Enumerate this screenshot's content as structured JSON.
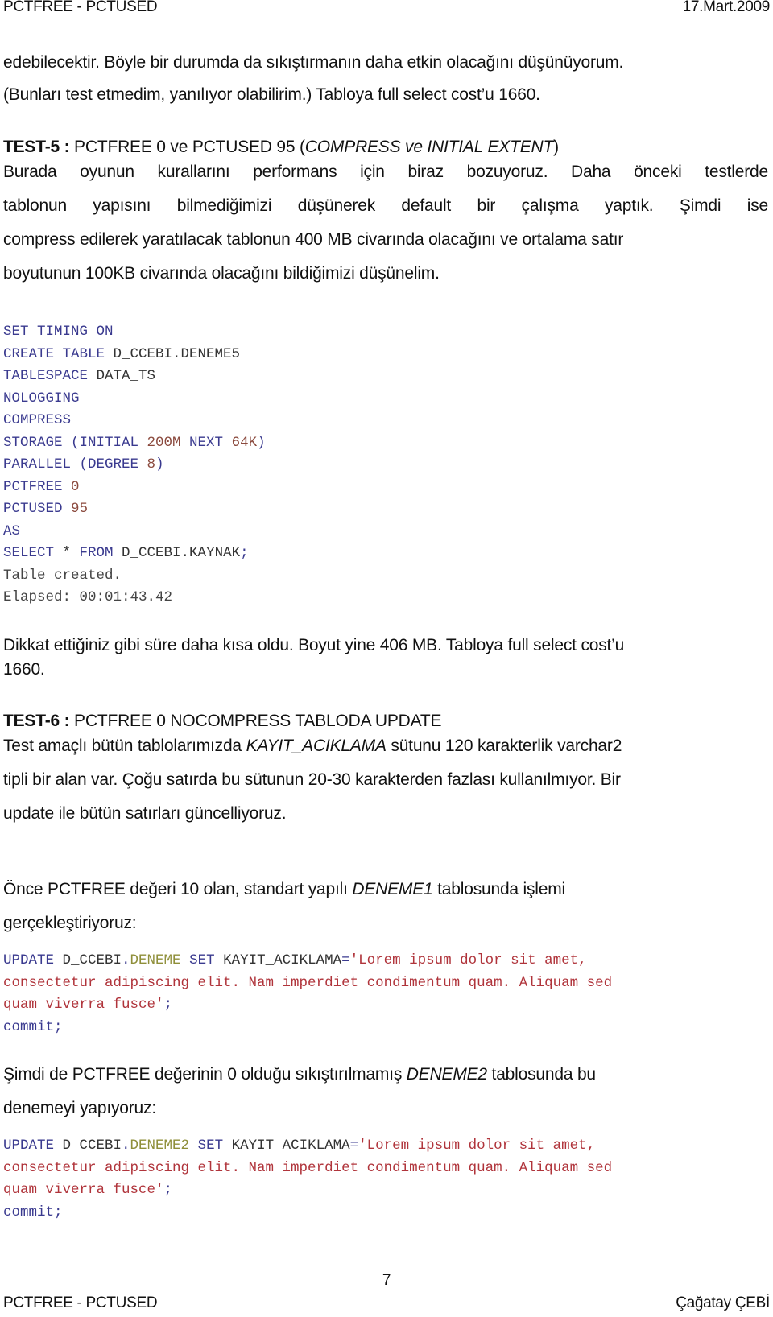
{
  "header": {
    "title": "PCTFREE - PCTUSED",
    "date": "17.Mart.2009"
  },
  "paragraphs": {
    "intro_line1": "edebilecektir. Böyle bir durumda da sıkıştırmanın daha etkin olacağını düşünüyorum.",
    "intro_line2": "(Bunları test etmedim, yanılıyor olabilirim.) Tabloya full select cost’u 1660.",
    "test5_label": "TEST-5 :",
    "test5_title_a": " PCTFREE 0 ve PCTUSED 95 (",
    "test5_title_italic": "COMPRESS ve INITIAL EXTENT",
    "test5_title_b": ")",
    "test5_line1": "Burada oyunun kurallarını performans için biraz bozuyoruz. Daha önceki testlerde",
    "test5_line2": "tablonun yapısını bilmediğimizi düşünerek default bir çalışma yaptık. Şimdi ise",
    "test5_line3": "compress edilerek yaratılacak tablonun 400 MB civarında olacağını ve ortalama satır",
    "test5_line4": "boyutunun 100KB civarında olacağını bildiğimizi düşünelim.",
    "result5_line1": "Dikkat ettiğiniz gibi süre daha kısa oldu. Boyut yine 406 MB. Tabloya full select cost’u",
    "result5_line2": "1660.",
    "test6_label": "TEST-6 :",
    "test6_title": " PCTFREE 0 NOCOMPRESS TABLODA UPDATE",
    "test6_line1_a": "Test amaçlı bütün tablolarımızda ",
    "test6_line1_italic": "KAYIT_ACIKLAMA",
    "test6_line1_b": " sütunu 120 karakterlik varchar2",
    "test6_line2": "tipli bir alan var. Çoğu satırda bu sütunun 20-30 karakterden fazlası kullanılmıyor. Bir",
    "test6_line3": "update ile bütün satırları güncelliyoruz.",
    "once_line1_a": "Önce PCTFREE değeri 10 olan, standart yapılı ",
    "once_line1_italic": "DENEME1",
    "once_line1_b": " tablosunda işlemi",
    "once_line2": "gerçekleştiriyoruz:",
    "simdi_line1_a": "Şimdi de PCTFREE değerinin 0 olduğu sıkıştırılmamış ",
    "simdi_line1_italic": "DENEME2",
    "simdi_line1_b": "  tablosunda bu",
    "simdi_line2": "denemeyi yapıyoruz:"
  },
  "code_block_1": {
    "l1": "SET TIMING ON",
    "l2_kw": "CREATE TABLE ",
    "l2_id": "D_CCEBI.DENEME5",
    "l3_kw": "TABLESPACE ",
    "l3_id": "DATA_TS",
    "l4": "NOLOGGING",
    "l5": "COMPRESS",
    "l6_kw1": "STORAGE (INITIAL ",
    "l6_num1": "200M",
    "l6_kw2": " NEXT ",
    "l6_num2": "64K",
    "l6_kw3": ")",
    "l7_kw1": "PARALLEL (DEGREE ",
    "l7_num": "8",
    "l7_kw2": ")",
    "l8_kw": "PCTFREE ",
    "l8_num": "0",
    "l9_kw": "PCTUSED ",
    "l9_num": "95",
    "l10": "AS",
    "l11_kw1": "SELECT",
    "l11_id1": " * ",
    "l11_kw2": "FROM ",
    "l11_id2": "D_CCEBI.KAYNAK",
    "l11_kw3": ";",
    "l12": "Table created.",
    "l13": "Elapsed: 00:01:43.42"
  },
  "code_block_2": {
    "l1_kw1": "UPDATE ",
    "l1_id1": "D_CCEBI",
    "l1_dot": ".",
    "l1_obj": "DENEME",
    "l1_kw2": " SET ",
    "l1_id2": "KAYIT_ACIKLAMA",
    "l1_eq": "=",
    "l1_str": "'Lorem ipsum dolor sit amet,",
    "l2_str": "consectetur adipiscing elit. Nam imperdiet condimentum quam. Aliquam sed",
    "l3_str": "quam viverra fusce'",
    "l3_semi": ";",
    "l4": "commit;"
  },
  "code_block_3": {
    "l1_kw1": "UPDATE ",
    "l1_id1": "D_CCEBI",
    "l1_dot": ".",
    "l1_obj": "DENEME2",
    "l1_kw2": " SET ",
    "l1_id2": "KAYIT_ACIKLAMA",
    "l1_eq": "=",
    "l1_str": "'Lorem ipsum dolor sit amet,",
    "l2_str": "consectetur adipiscing elit. Nam imperdiet condimentum quam. Aliquam sed",
    "l3_str": "quam viverra fusce'",
    "l3_semi": ";",
    "l4": "commit;"
  },
  "footer": {
    "page_number": "7",
    "title": "PCTFREE - PCTUSED",
    "author": "Çağatay ÇEBİ"
  }
}
